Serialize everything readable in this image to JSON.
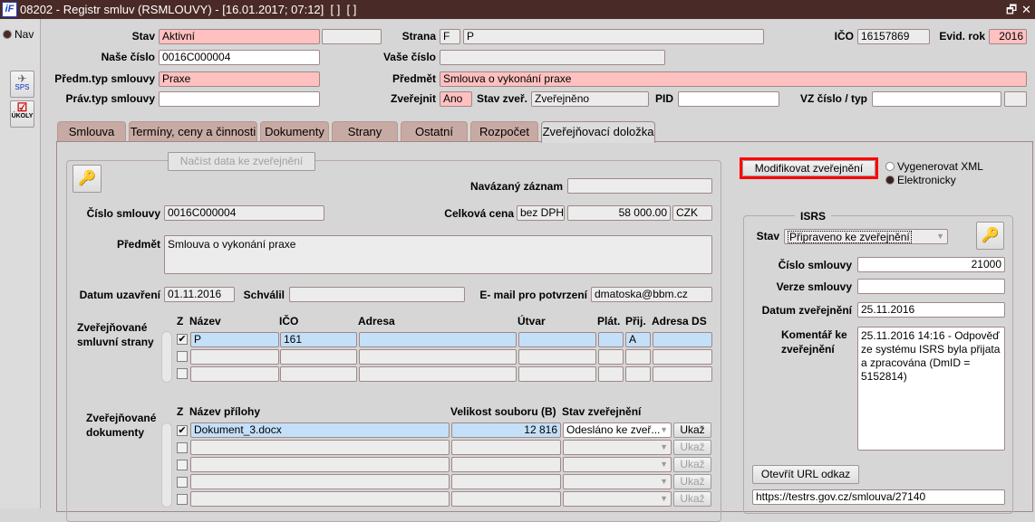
{
  "window": {
    "title": "08202 - Registr smluv (RSMLOUVY) - [16.01.2017; 07:12]  [ ]  [ ]",
    "logo": "iF"
  },
  "nav": {
    "radio_label": "Nav",
    "sps_label": "SPS",
    "ukoly_label": "ÚKOLY"
  },
  "header": {
    "stav_label": "Stav",
    "stav": "Aktivní",
    "stav2": "",
    "strana_label": "Strana",
    "strana_type": "F",
    "strana_name": "P",
    "ico_label": "IČO",
    "ico": "16157869",
    "evid_rok_label": "Evid. rok",
    "evid_rok": "2016",
    "nase_cislo_label": "Naše číslo",
    "nase_cislo": "0016C000004",
    "vase_cislo_label": "Vaše číslo",
    "vase_cislo": "",
    "predm_typ_label": "Předm.typ smlouvy",
    "predm_typ": "Praxe",
    "predmet_label": "Předmět",
    "predmet": "Smlouva o vykonání praxe",
    "prav_typ_label": "Práv.typ smlouvy",
    "prav_typ": "",
    "zverejnit_label": "Zveřejnit",
    "zverejnit": "Ano",
    "stav_zver_label": "Stav zveř.",
    "stav_zver": "Zveřejněno",
    "pid_label": "PID",
    "pid": "",
    "vz_label": "VZ číslo / typ",
    "vz": "",
    "vz_typ": ""
  },
  "tabs": [
    "Smlouva",
    "Termíny, ceny a činnosti",
    "Dokumenty",
    "Strany",
    "Ostatní",
    "Rozpočet",
    "Zveřejňovací doložka"
  ],
  "publish": {
    "load_button": "Načíst data ke zveřejnění",
    "navazany_label": "Navázaný záznam",
    "navazany": "",
    "cislo_label": "Číslo smlouvy",
    "cislo": "0016C000004",
    "cena_label": "Celková cena",
    "cena_typ": "bez DPH",
    "cena": "58 000.00",
    "mena": "CZK",
    "predmet_label": "Předmět",
    "predmet": "Smlouva o vykonání praxe",
    "datum_label": "Datum uzavření",
    "datum": "01.11.2016",
    "schvalil_label": "Schválil",
    "schvalil": "",
    "email_label": "E- mail pro potvrzení",
    "email": "dmatoska@bbm.cz",
    "parties": {
      "label": "Zveřejňované smluvní strany",
      "columns": [
        "Z",
        "Název",
        "IČO",
        "Adresa",
        "Útvar",
        "Plát.",
        "Přij.",
        "Adresa DS"
      ],
      "rows": [
        {
          "checked": true,
          "cells": [
            "P",
            "161",
            "",
            "",
            "",
            "A",
            ""
          ]
        },
        {
          "checked": false,
          "cells": [
            "",
            "",
            "",
            "",
            "",
            "",
            ""
          ]
        },
        {
          "checked": false,
          "cells": [
            "",
            "",
            "",
            "",
            "",
            "",
            ""
          ]
        }
      ]
    },
    "documents": {
      "label": "Zveřejňované dokumenty",
      "columns": [
        "Z",
        "Název přílohy",
        "Velikost souboru (B)",
        "Stav zveřejnění"
      ],
      "show_label": "Ukaž",
      "rows": [
        {
          "checked": true,
          "name": "Dokument_3.docx",
          "size": "12 816",
          "status": "Odesláno ke zveř...",
          "enabled": true
        },
        {
          "checked": false,
          "name": "",
          "size": "",
          "status": "",
          "enabled": false
        },
        {
          "checked": false,
          "name": "",
          "size": "",
          "status": "",
          "enabled": false
        },
        {
          "checked": false,
          "name": "",
          "size": "",
          "status": "",
          "enabled": false
        },
        {
          "checked": false,
          "name": "",
          "size": "",
          "status": "",
          "enabled": false
        }
      ]
    }
  },
  "right": {
    "modify_button": "Modifikovat zveřejnění",
    "radio_xml": "Vygenerovat XML",
    "radio_el": "Elektronicky",
    "selected": "Elektronicky",
    "isrs_title": "ISRS",
    "stav_label": "Stav",
    "stav": "Připraveno ke zveřejnění",
    "cislo_label": "Číslo smlouvy",
    "cislo": "21000",
    "verze_label": "Verze smlouvy",
    "verze": "",
    "datum_label": "Datum zveřejnění",
    "datum": "25.11.2016",
    "komentar_label": "Komentář ke zveřejnění",
    "komentar": "25.11.2016 14:16 - Odpověď ze systému ISRS byla přijata a zpracována (DmID = 5152814)",
    "url_button": "Otevřít URL odkaz",
    "url": "https://testrs.gov.cz/smlouva/27140"
  },
  "colors": {
    "titlebar": "#4a2a26",
    "required": "#ffc0c0",
    "selected_row": "#c4e0f8",
    "highlight": "#ff0000"
  }
}
